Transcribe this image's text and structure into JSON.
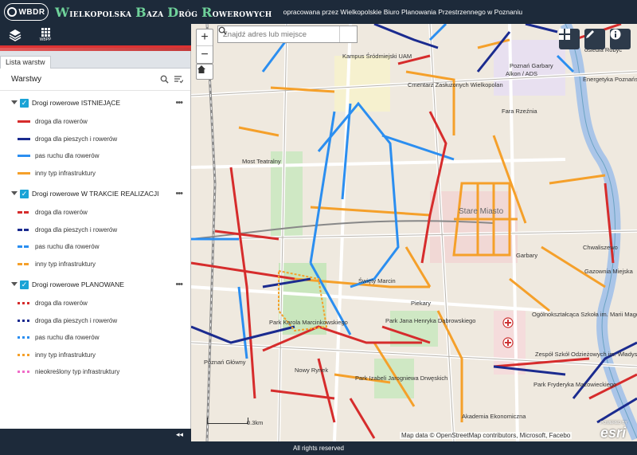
{
  "header": {
    "logo_text": "WBDR",
    "title_parts": [
      {
        "cap": "W",
        "rest": "ielkopolska "
      },
      {
        "cap": "B",
        "rest": "aza "
      },
      {
        "cap": "D",
        "rest": "róg "
      },
      {
        "cap": "R",
        "rest": "owerowych"
      }
    ],
    "subtitle": "opracowana przez Wielkopolskie Biuro Planowania Przestrzennego w Poznaniu"
  },
  "toolbar": {
    "layers_icon": "layers-icon",
    "wbpp_label": "WBPP"
  },
  "panel": {
    "tab_label": "Lista warstw",
    "heading": "Warstwy",
    "groups": [
      {
        "label": "Drogi rowerowe ISTNIEJĄCE",
        "items": [
          {
            "label": "droga dla rowerów",
            "color": "#d62c2c",
            "style": "solid"
          },
          {
            "label": "droga dla pieszych i rowerów",
            "color": "#1b2b8f",
            "style": "solid"
          },
          {
            "label": "pas ruchu dla rowerów",
            "color": "#2b8ef0",
            "style": "solid"
          },
          {
            "label": "inny typ infrastruktury",
            "color": "#f5a02a",
            "style": "solid"
          }
        ]
      },
      {
        "label": "Drogi rowerowe W TRAKCIE REALIZACJI",
        "items": [
          {
            "label": "droga dla rowerów",
            "color": "#d62c2c",
            "style": "dash"
          },
          {
            "label": "droga dla pieszych i rowerów",
            "color": "#1b2b8f",
            "style": "dash"
          },
          {
            "label": "pas ruchu dla rowerów",
            "color": "#2b8ef0",
            "style": "dash"
          },
          {
            "label": "inny typ infrastruktury",
            "color": "#f5a02a",
            "style": "dash"
          }
        ]
      },
      {
        "label": "Drogi rowerowe PLANOWANE",
        "items": [
          {
            "label": "droga dla rowerów",
            "color": "#d62c2c",
            "style": "dot"
          },
          {
            "label": "droga dla pieszych i rowerów",
            "color": "#1b2b8f",
            "style": "dot"
          },
          {
            "label": "pas ruchu dla rowerów",
            "color": "#2b8ef0",
            "style": "dot"
          },
          {
            "label": "inny typ infrastruktury",
            "color": "#f5a02a",
            "style": "dot"
          },
          {
            "label": "nieokreślony typ infrastruktury",
            "color": "#f06bc8",
            "style": "dot"
          }
        ]
      }
    ]
  },
  "map": {
    "search_placeholder": "Znajdź adres lub miejsce",
    "zoom_in": "+",
    "zoom_out": "−",
    "scale_label": "0.3km",
    "attribution": "Map data © OpenStreetMap contributors, Microsoft, Facebo",
    "esri_label": "esri",
    "esri_powered": "POWERED BY",
    "labels": [
      {
        "text": "Stare Miasto",
        "cls": "big"
      },
      {
        "text": "Most Teatralny",
        "cls": "dark"
      },
      {
        "text": "Kampus Śródmiejski UAM",
        "cls": "dark"
      },
      {
        "text": "Cmentarz Zasłużonych Wielkopolan",
        "cls": "dark"
      },
      {
        "text": "Poznań Garbary",
        "cls": "dark"
      },
      {
        "text": "Alkon / ADS",
        "cls": "dark"
      },
      {
        "text": "Fara Rzeźnia",
        "cls": "dark"
      },
      {
        "text": "Energetyka Poznańska",
        "cls": "dark"
      },
      {
        "text": "Chwaliszewo",
        "cls": "dark"
      },
      {
        "text": "Garbary",
        "cls": "dark"
      },
      {
        "text": "Gazownia Miejska",
        "cls": "dark"
      },
      {
        "text": "Święty Marcin",
        "cls": "dark"
      },
      {
        "text": "Piekary",
        "cls": "dark"
      },
      {
        "text": "Park Jana Henryka Dąbrowskiego",
        "cls": "dark"
      },
      {
        "text": "Park Karola Marcinkowskiego",
        "cls": "dark"
      },
      {
        "text": "Nowy Rynek",
        "cls": "dark"
      },
      {
        "text": "Poznań Główny",
        "cls": "dark"
      },
      {
        "text": "Park Izabeli Jarogniewa Drwęskich",
        "cls": "dark"
      },
      {
        "text": "Akademia Ekonomiczna",
        "cls": "dark"
      },
      {
        "text": "osiedla Robyć",
        "cls": "dark"
      },
      {
        "text": "Park Fryderyka Mazowieckiego",
        "cls": "dark"
      },
      {
        "text": "Ogólnokształcąca Szkoła im. Marii Magdaleny",
        "cls": "dark"
      },
      {
        "text": "Zespół Szkół Odzieżowych im. Władysława Reymonta",
        "cls": "dark"
      }
    ]
  },
  "footer": {
    "text": "All rights reserved",
    "collapse": "◂◂"
  },
  "colors": {
    "header_bg": "#1d2a3a",
    "accent_green": "#6fd29a",
    "checkbox": "#1aa3d6"
  }
}
